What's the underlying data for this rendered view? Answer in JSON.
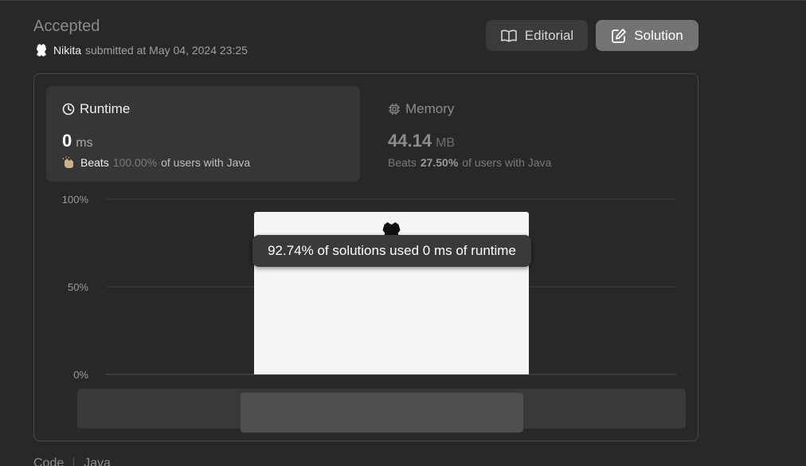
{
  "submission": {
    "status": "Accepted",
    "user": "Nikita",
    "submitted_text": "submitted at May 04, 2024 23:25"
  },
  "buttons": {
    "editorial": "Editorial",
    "solution": "Solution"
  },
  "runtime": {
    "label": "Runtime",
    "value": "0",
    "unit": "ms",
    "beats_label": "Beats",
    "beats_pct": "100.00%",
    "beats_suffix": "of users with Java"
  },
  "memory": {
    "label": "Memory",
    "value": "44.14",
    "unit": "MB",
    "beats_label": "Beats",
    "beats_pct": "27.50%",
    "beats_suffix": "of users with Java"
  },
  "chart_data": {
    "type": "bar",
    "y_ticks": [
      "100%",
      "50%",
      "0%"
    ],
    "ylim": [
      0,
      100
    ],
    "grid": true,
    "bars": [
      {
        "x": "0 ms",
        "value": 92.74,
        "highlighted": true
      }
    ],
    "tooltip": "92.74% of solutions used 0 ms of runtime"
  },
  "bottom_tabs": {
    "code": "Code",
    "language": "Java"
  },
  "colors": {
    "bar": "#f5f5f5",
    "selected_range": "#4f4f4f",
    "scroll_track": "#393939",
    "accent_button": "#737373"
  }
}
